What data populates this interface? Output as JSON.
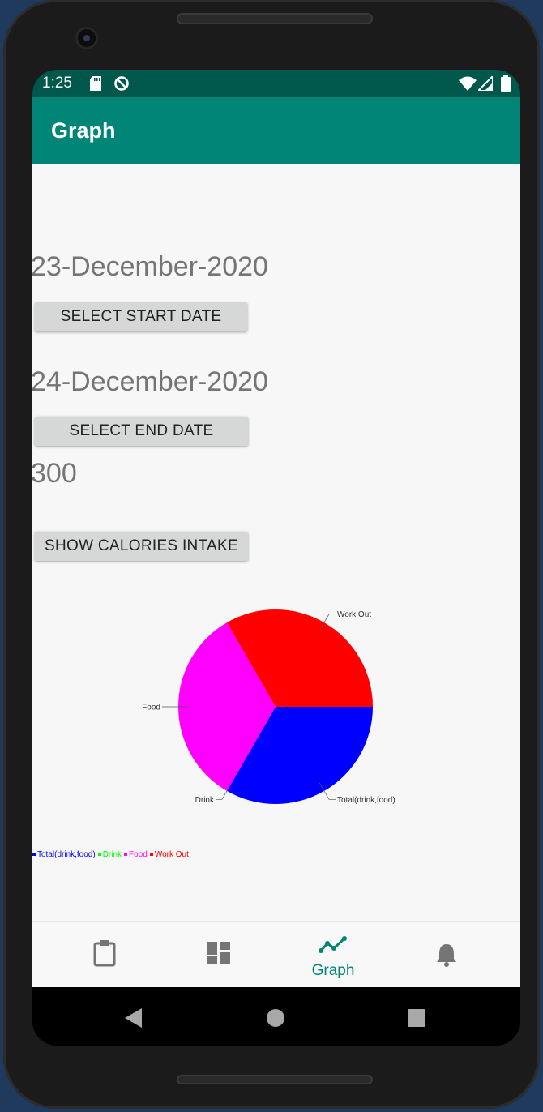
{
  "status_bar": {
    "time": "1:25",
    "icons": [
      "sd-card-icon",
      "sync-icon",
      "wifi-icon",
      "signal-icon",
      "battery-icon"
    ]
  },
  "app_bar": {
    "title": "Graph"
  },
  "form": {
    "start_date": "23-December-2020",
    "start_button": "SELECT START DATE",
    "end_date": "24-December-2020",
    "end_button": "SELECT END DATE",
    "calories_value": "300",
    "show_button": "SHOW CALORIES INTAKE"
  },
  "chart_data": {
    "type": "pie",
    "title": "",
    "slices": [
      {
        "label": "Total(drink,food)",
        "value": 1,
        "color": "#0000ff"
      },
      {
        "label": "Drink",
        "value": 0,
        "color": "#00ff00"
      },
      {
        "label": "Food",
        "value": 1,
        "color": "#ff00ff"
      },
      {
        "label": "Work Out",
        "value": 1,
        "color": "#ff0000"
      }
    ],
    "legend_position": "bottom-left"
  },
  "bottom_nav": {
    "items": [
      {
        "icon": "clipboard-icon",
        "label": ""
      },
      {
        "icon": "dashboard-icon",
        "label": ""
      },
      {
        "icon": "graph-icon",
        "label": "Graph",
        "active": true
      },
      {
        "icon": "bell-icon",
        "label": ""
      }
    ]
  },
  "system_nav": {
    "icons": [
      "back-icon",
      "home-icon",
      "recents-icon"
    ]
  },
  "colors": {
    "primary": "#008577",
    "primary_dark": "#00574b",
    "background": "#f7f7f7",
    "button": "#d6d7d7"
  }
}
